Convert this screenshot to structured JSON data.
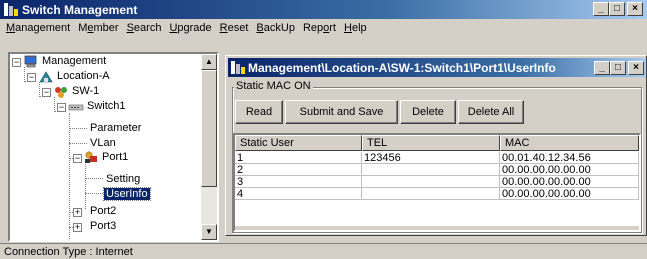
{
  "window": {
    "title": "Switch Management",
    "buttons": [
      "_",
      "□",
      "×"
    ]
  },
  "menubar": [
    {
      "label": "Management",
      "u": "M"
    },
    {
      "label": "Member",
      "u": "e"
    },
    {
      "label": "Search",
      "u": "S"
    },
    {
      "label": "Upgrade",
      "u": "U"
    },
    {
      "label": "Reset",
      "u": "R"
    },
    {
      "label": "BackUp",
      "u": "B"
    },
    {
      "label": "Report",
      "u": "o"
    },
    {
      "label": "Help",
      "u": "H"
    }
  ],
  "tree": {
    "nodes": [
      {
        "label": "Management",
        "icon": "computer-icon",
        "expander": "−"
      },
      {
        "label": "Location-A",
        "icon": "location-icon",
        "expander": "−"
      },
      {
        "label": "SW-1",
        "icon": "switch-group-icon",
        "expander": "−"
      },
      {
        "label": "Switch1",
        "icon": "switch-device-icon",
        "expander": "−"
      },
      {
        "label": "Parameter",
        "icon": "",
        "expander": ""
      },
      {
        "label": "VLan",
        "icon": "",
        "expander": ""
      },
      {
        "label": "Port1",
        "icon": "port-icon",
        "expander": "−"
      },
      {
        "label": "Setting",
        "icon": "",
        "expander": ""
      },
      {
        "label": "UserInfo",
        "icon": "",
        "expander": "",
        "selected": true
      },
      {
        "label": "Port2",
        "icon": "",
        "expander": "+"
      },
      {
        "label": "Port3",
        "icon": "",
        "expander": "+"
      }
    ]
  },
  "child": {
    "title": "Management\\Location-A\\SW-1:Switch1\\Port1\\UserInfo",
    "group_label": "Static MAC ON",
    "buttons": {
      "read": "Read",
      "submit": "Submit and Save",
      "delete": "Delete",
      "delete_all": "Delete All"
    },
    "table": {
      "columns": [
        "Static User",
        "TEL",
        "MAC"
      ],
      "rows": [
        [
          "1",
          "123456",
          "00.01.40.12.34.56"
        ],
        [
          "2",
          "",
          "00.00.00.00.00.00"
        ],
        [
          "3",
          "",
          "00.00.00.00.00.00"
        ],
        [
          "4",
          "",
          "00.00.00.00.00.00"
        ]
      ]
    }
  },
  "status": {
    "text": "Connection Type : Internet"
  }
}
